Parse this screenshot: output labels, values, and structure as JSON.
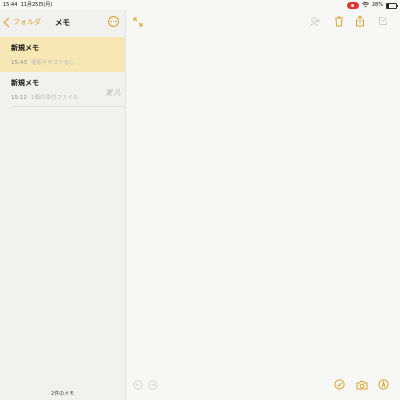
{
  "status_bar": {
    "time": "15:44",
    "date": "11月25日(月)",
    "battery": "28%"
  },
  "sidebar": {
    "back_label": "フォルダ",
    "title": "メモ",
    "notes": [
      {
        "title": "新規メモ",
        "time": "15:43",
        "preview": "追加テキストなし",
        "selected": true
      },
      {
        "title": "新規メモ",
        "time": "15:12",
        "preview": "1個の添付ファイル",
        "thumbnail_text": "寛 凡",
        "selected": false
      }
    ],
    "count_label": "2件のメモ"
  },
  "colors": {
    "accent": "#d8a32a",
    "selected_row": "#f6e7b4",
    "record_pill": "#e0352e"
  },
  "icons": {
    "top_left": "expand-icon",
    "top_right": [
      "collaborate-icon",
      "trash-icon",
      "share-icon",
      "compose-icon"
    ],
    "bottom_left": [
      "undo-icon",
      "redo-icon"
    ],
    "bottom_right": [
      "checklist-icon",
      "camera-icon",
      "pen-icon"
    ]
  }
}
